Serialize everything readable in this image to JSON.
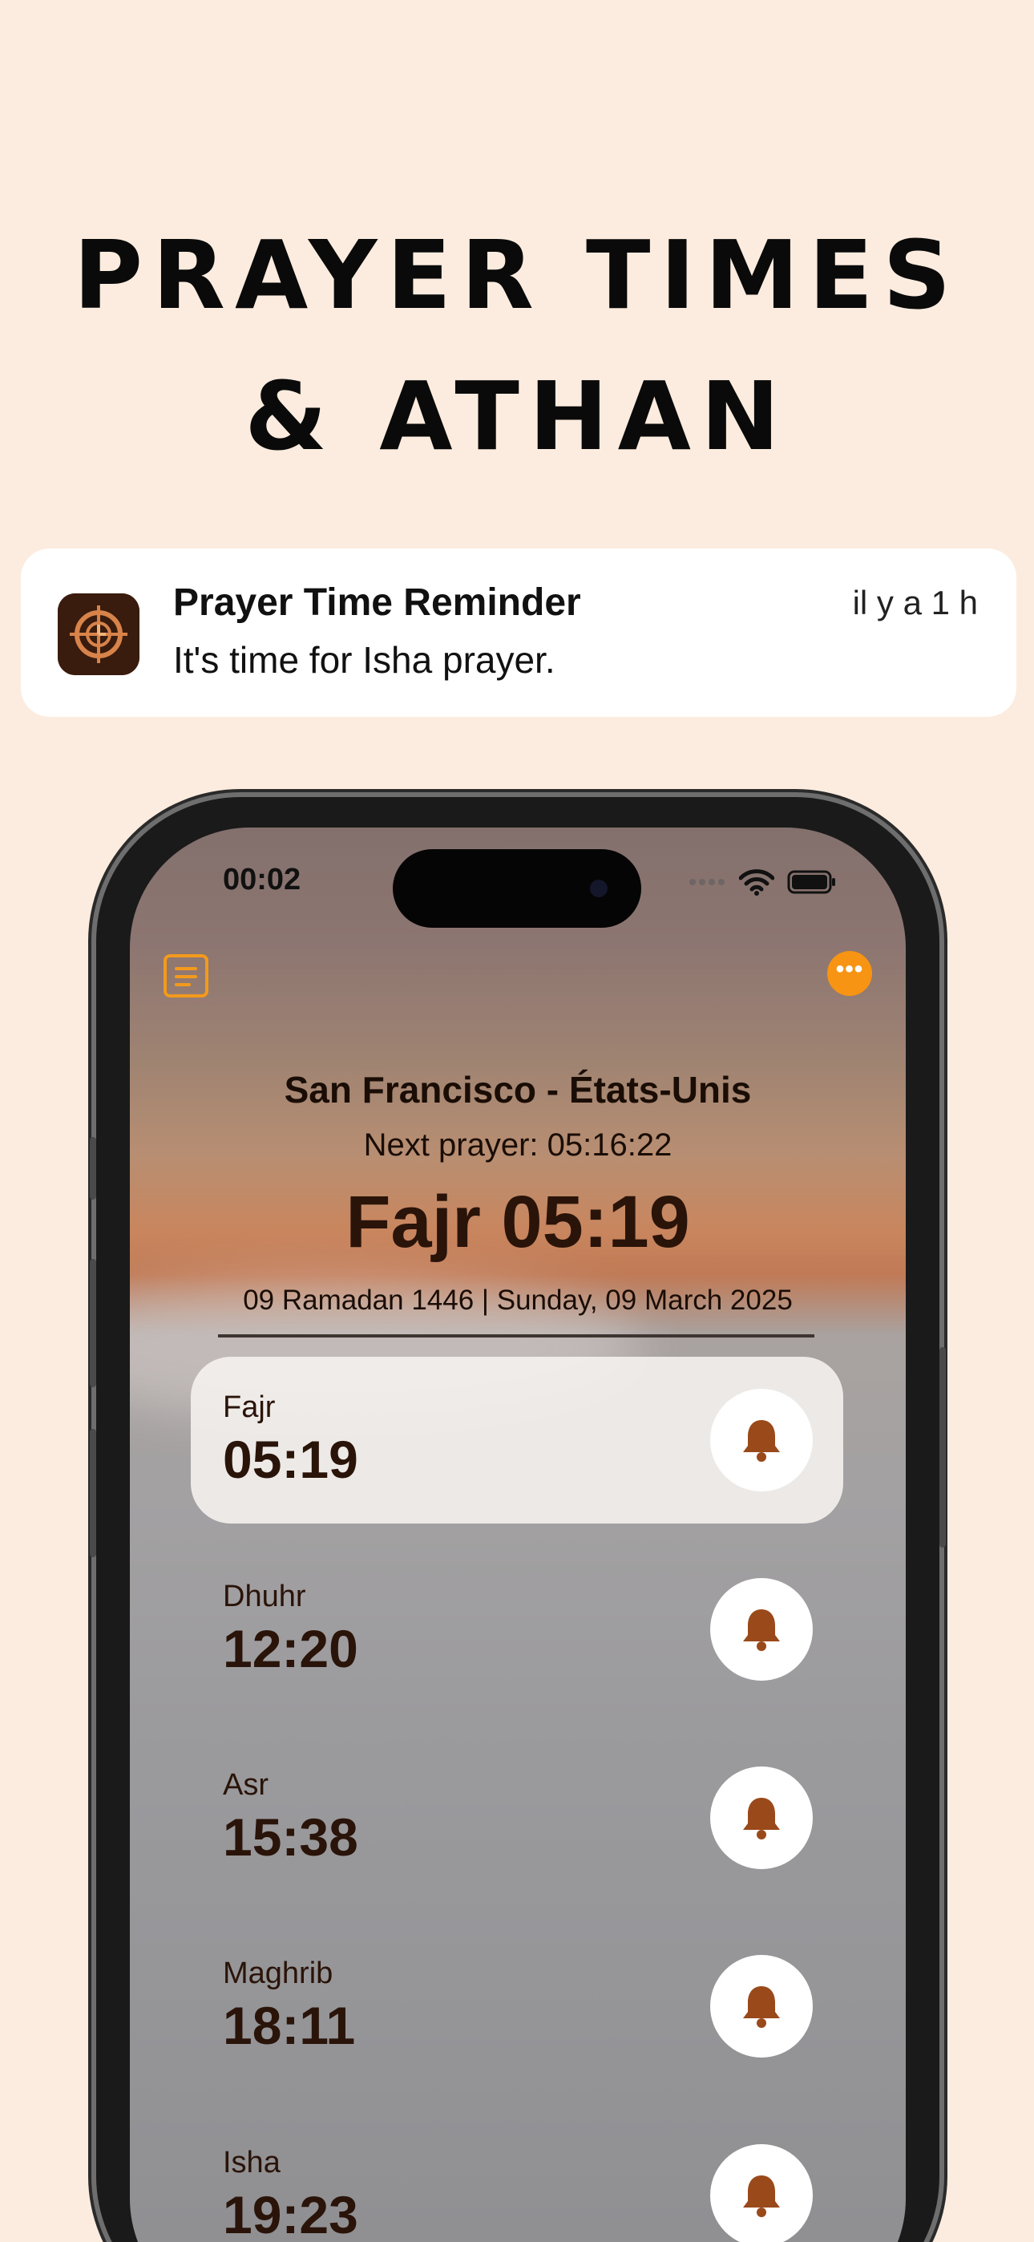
{
  "headline": {
    "line1": "PRAYER TIMES",
    "line2": "& ATHAN"
  },
  "notification": {
    "app_icon": "prayer-compass-clock-icon",
    "title": "Prayer Time Reminder",
    "body": "It's time for Isha prayer.",
    "time": "il y a 1 h"
  },
  "status_bar": {
    "time": "00:02",
    "icons": [
      "cellular-dots-icon",
      "wifi-icon",
      "battery-icon"
    ]
  },
  "toolbar": {
    "menu_icon": "list-icon",
    "more_icon": "ellipsis-icon"
  },
  "header": {
    "location": "San Francisco - États-Unis",
    "next_prayer": "Next prayer: 05:16:22",
    "current_prayer": "Fajr 05:19",
    "date": "09 Ramadan 1446 | Sunday, 09 March 2025"
  },
  "prayers": [
    {
      "name": "Fajr",
      "time": "05:19",
      "active": true
    },
    {
      "name": "Dhuhr",
      "time": "12:20",
      "active": false
    },
    {
      "name": "Asr",
      "time": "15:38",
      "active": false
    },
    {
      "name": "Maghrib",
      "time": "18:11",
      "active": false
    },
    {
      "name": "Isha",
      "time": "19:23",
      "active": false
    }
  ],
  "colors": {
    "background": "#FCECDF",
    "accent": "#F39A1C",
    "bell": "#9A4A1A",
    "text_dark": "#2A140A"
  }
}
